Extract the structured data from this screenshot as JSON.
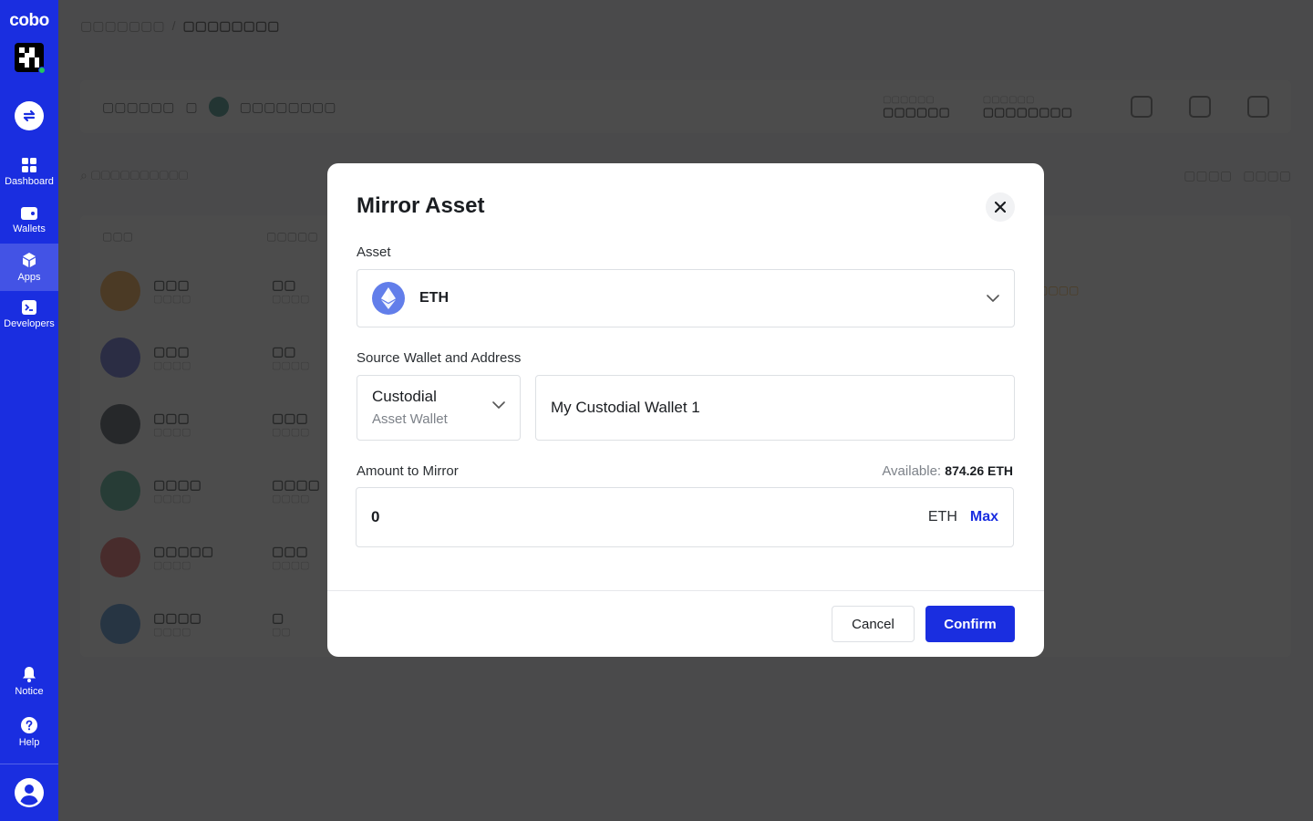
{
  "sidebar": {
    "logo": "cobo",
    "nav": [
      {
        "label": "Dashboard",
        "icon": "dashboard-icon"
      },
      {
        "label": "Wallets",
        "icon": "wallet-icon"
      },
      {
        "label": "Apps",
        "icon": "cube-icon",
        "active": true
      },
      {
        "label": "Developers",
        "icon": "terminal-icon"
      }
    ],
    "bottom": [
      {
        "label": "Notice",
        "icon": "bell-icon"
      },
      {
        "label": "Help",
        "icon": "help-icon"
      }
    ]
  },
  "modal": {
    "title": "Mirror Asset",
    "asset_label": "Asset",
    "asset_value": "ETH",
    "source_label": "Source Wallet and Address",
    "wallet_type": "Custodial",
    "wallet_subtype": "Asset Wallet",
    "wallet_name": "My Custodial Wallet 1",
    "amount_label": "Amount to Mirror",
    "available_label": "Available:",
    "available_value": "874.26 ETH",
    "amount_value": "0",
    "amount_unit": "ETH",
    "max_label": "Max",
    "cancel_label": "Cancel",
    "confirm_label": "Confirm"
  },
  "colors": {
    "brand": "#1a2ee0",
    "eth": "#627eea"
  }
}
